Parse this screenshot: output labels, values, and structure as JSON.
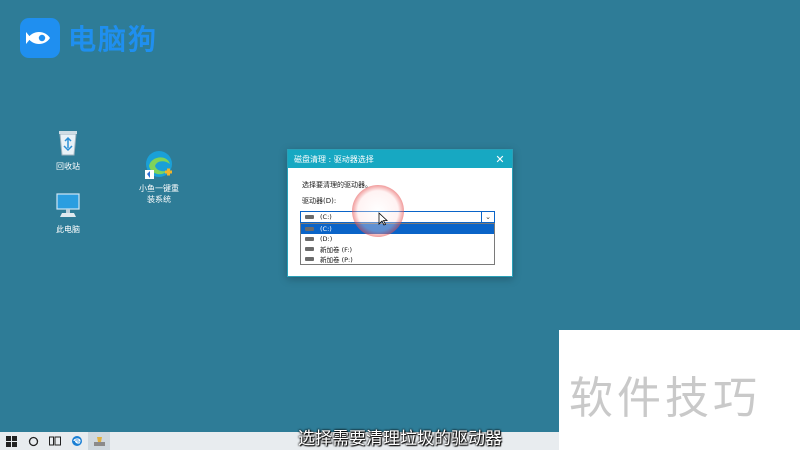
{
  "watermark": {
    "logo_text": "电脑狗"
  },
  "desktop": {
    "icons": [
      {
        "label": "回收站"
      },
      {
        "label": "小鱼一键重\n装系统"
      },
      {
        "label": "此电脑"
      }
    ]
  },
  "dialog": {
    "title": "磁盘清理 : 驱动器选择",
    "prompt": "选择要清理的驱动器。",
    "drive_label": "驱动器(D):",
    "selected_value": "(C:)",
    "options": [
      "(C:)",
      "(D:)",
      "新加卷 (F:)",
      "新加卷 (P:)"
    ]
  },
  "tips_watermark": "软件技巧",
  "caption": "选择需要清理垃圾的驱动器",
  "colors": {
    "desktop_bg": "#2e7c97",
    "titlebar": "#17a8c2",
    "selection": "#0a64c8"
  }
}
